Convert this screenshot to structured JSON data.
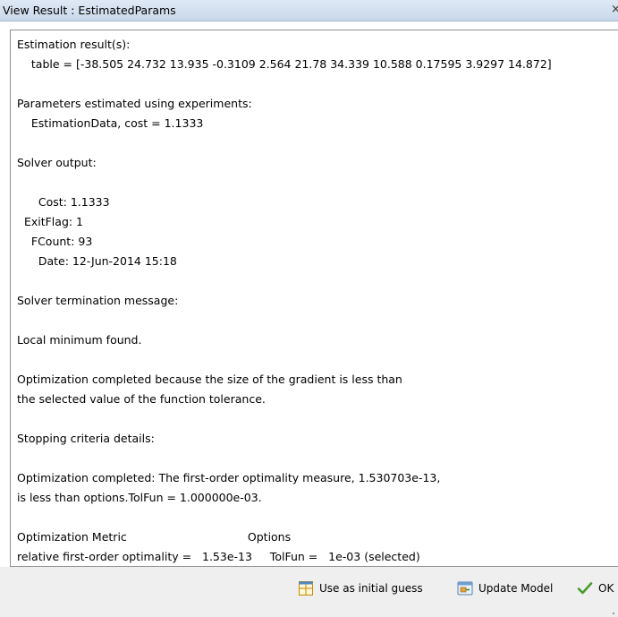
{
  "window": {
    "title": "View Result : EstimatedParams",
    "close_glyph": "×"
  },
  "report": {
    "lines": [
      "Estimation result(s):",
      "    table = [-38.505 24.732 13.935 -0.3109 2.564 21.78 34.339 10.588 0.17595 3.9297 14.872]",
      "",
      "Parameters estimated using experiments:",
      "    EstimationData, cost = 1.1333",
      "",
      "Solver output:",
      "",
      "      Cost: 1.1333",
      "  ExitFlag: 1",
      "    FCount: 93",
      "      Date: 12-Jun-2014 15:18",
      "",
      "Solver termination message:",
      "",
      "Local minimum found.",
      "",
      "Optimization completed because the size of the gradient is less than",
      "the selected value of the function tolerance.",
      "",
      "Stopping criteria details:",
      "",
      "Optimization completed: The first-order optimality measure, 1.530703e-13,",
      "is less than options.TolFun = 1.000000e-03.",
      "",
      "Optimization Metric                                  Options",
      "relative first-order optimality =   1.53e-13     TolFun =   1e-03 (selected)"
    ]
  },
  "footer": {
    "use_initial_guess_label": "Use as initial guess",
    "update_model_label": "Update Model",
    "ok_label": "OK"
  }
}
